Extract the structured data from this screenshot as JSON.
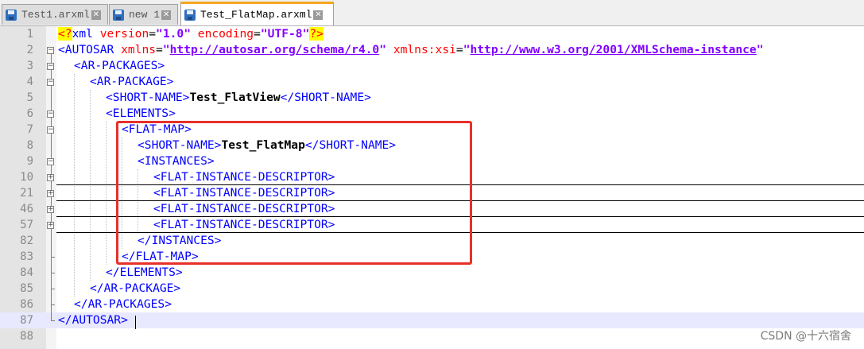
{
  "tabs": [
    {
      "label": "Test1.arxml"
    },
    {
      "label": "new 1"
    },
    {
      "label": "Test_FlatMap.arxml"
    }
  ],
  "lines": [
    {
      "num": "1"
    },
    {
      "num": "2"
    },
    {
      "num": "3",
      "text": "<AR-PACKAGES>"
    },
    {
      "num": "4",
      "text": "<AR-PACKAGE>"
    },
    {
      "num": "5",
      "open": "<SHORT-NAME>",
      "value": "Test_FlatView",
      "close": "</SHORT-NAME>"
    },
    {
      "num": "6",
      "text": "<ELEMENTS>"
    },
    {
      "num": "7",
      "text": "<FLAT-MAP>"
    },
    {
      "num": "8",
      "open": "<SHORT-NAME>",
      "value": "Test_FlatMap",
      "close": "</SHORT-NAME>"
    },
    {
      "num": "9",
      "text": "<INSTANCES>"
    },
    {
      "num": "10",
      "text": "<FLAT-INSTANCE-DESCRIPTOR>"
    },
    {
      "num": "21",
      "text": "<FLAT-INSTANCE-DESCRIPTOR>"
    },
    {
      "num": "46",
      "text": "<FLAT-INSTANCE-DESCRIPTOR>"
    },
    {
      "num": "57",
      "text": "<FLAT-INSTANCE-DESCRIPTOR>"
    },
    {
      "num": "82",
      "text": "</INSTANCES>"
    },
    {
      "num": "83",
      "text": "</FLAT-MAP>"
    },
    {
      "num": "84",
      "text": "</ELEMENTS>"
    },
    {
      "num": "85",
      "text": "</AR-PACKAGE>"
    },
    {
      "num": "86",
      "text": "</AR-PACKAGES>"
    },
    {
      "num": "87",
      "text": "</AUTOSAR>"
    },
    {
      "num": "88"
    }
  ],
  "xml_decl": {
    "open": "<?",
    "name": "xml",
    "attr1": "version",
    "val1": "\"1.0\"",
    "attr2": "encoding",
    "val2": "\"UTF-8\"",
    "close": "?>"
  },
  "autosar_line": {
    "tag": "<AUTOSAR",
    "attr1": "xmlns",
    "q": "\"",
    "url1": "http://autosar.org/schema/r4.0",
    "attr2": "xmlns:xsi",
    "url2": "http://www.w3.org/2001/XMLSchema-instance"
  },
  "watermark": "CSDN @十六宿舍",
  "colors": {
    "tag": "#0000ff",
    "attribute": "#ff0000",
    "value": "#8000ff",
    "highlight": "#ffff00",
    "annotation_box": "#e8302a",
    "active_tab_accent": "#f5a623"
  }
}
